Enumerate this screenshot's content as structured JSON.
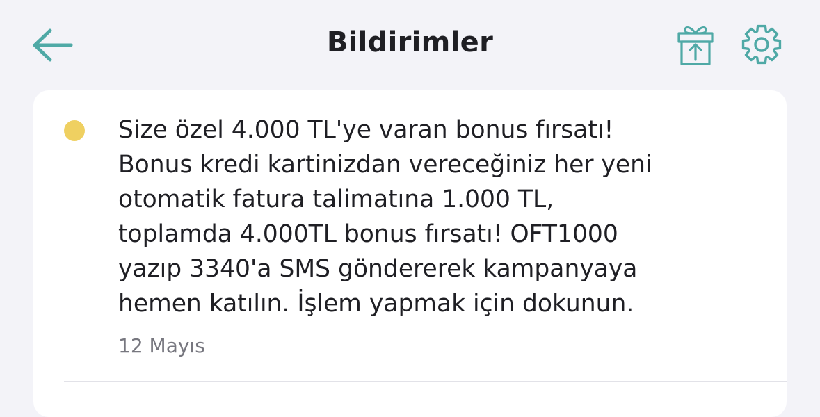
{
  "header": {
    "title": "Bildirimler",
    "back_icon": "arrow-left-icon",
    "gift_icon": "gift-icon",
    "settings_icon": "gear-icon"
  },
  "notifications": [
    {
      "unread": true,
      "message": "Size özel 4.000 TL'ye varan bonus fırsatı!\nBonus kredi kartinizdan vereceğiniz her yeni\notomatik fatura talimatına 1.000 TL,\ntoplamda 4.000TL bonus fırsatı! OFT1000\nyazıp 3340'a SMS göndererek kampanyaya\nhemen katılın. İşlem yapmak için dokunun.",
      "date": "12 Mayıs"
    }
  ],
  "colors": {
    "background": "#f3f3f8",
    "accent": "#4fa9a6",
    "unread_dot": "#efd061",
    "text": "#1f1f24",
    "muted": "#77777f"
  }
}
